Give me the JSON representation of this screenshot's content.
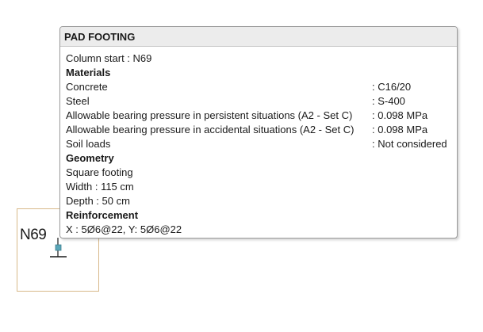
{
  "tooltip": {
    "title": "PAD FOOTING",
    "column_start": "Column start : N69",
    "materials": {
      "heading": "Materials",
      "rows": [
        {
          "label": "Concrete",
          "value": ": C16/20"
        },
        {
          "label": "Steel",
          "value": ": S-400"
        },
        {
          "label": "Allowable bearing pressure in persistent situations (A2 - Set C)",
          "value": ": 0.098 MPa"
        },
        {
          "label": "Allowable bearing pressure in accidental situations (A2 - Set C)",
          "value": ": 0.098 MPa"
        },
        {
          "label": "Soil loads",
          "value": ": Not considered"
        }
      ]
    },
    "geometry": {
      "heading": "Geometry",
      "type": "Square footing",
      "width": "Width : 115 cm",
      "depth": "Depth : 50 cm"
    },
    "reinforcement": {
      "heading": "Reinforcement",
      "value": "X : 5Ø6@22, Y: 5Ø6@22"
    }
  },
  "canvas": {
    "node_label": "N69",
    "footing_border_color": "#d8b98a",
    "column_marker_color": "#5aa6b8"
  }
}
